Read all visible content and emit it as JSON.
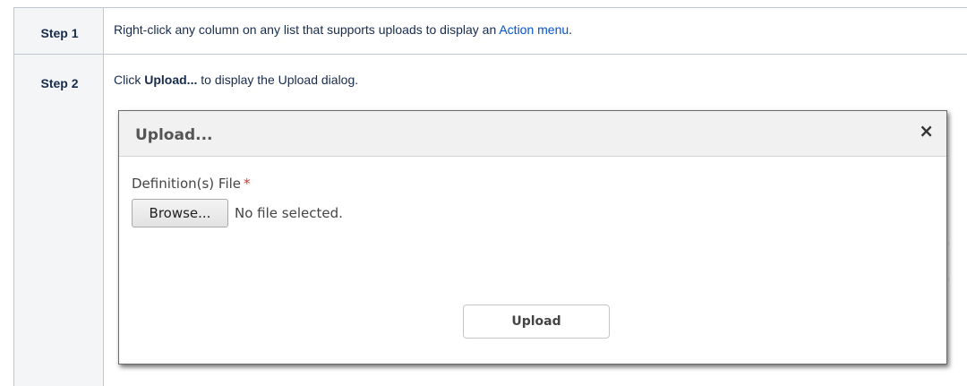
{
  "steps": [
    {
      "label": "Step 1",
      "text_before": "Right-click any column on any list that supports uploads to display an ",
      "link": "Action menu",
      "text_after": "."
    },
    {
      "label": "Step 2",
      "text_before": "Click ",
      "bold": "Upload...",
      "text_after": " to display the Upload dialog."
    }
  ],
  "dialog": {
    "title": "Upload...",
    "close_glyph": "×",
    "field_label": "Definition(s) File",
    "required_marker": "*",
    "browse_label": "Browse...",
    "file_status": "No file selected.",
    "upload_label": "Upload"
  },
  "colors": {
    "link": "#0052cc",
    "step_header_bg": "#f4f5f7",
    "border": "#c1c7d0",
    "required": "#d9362b"
  }
}
